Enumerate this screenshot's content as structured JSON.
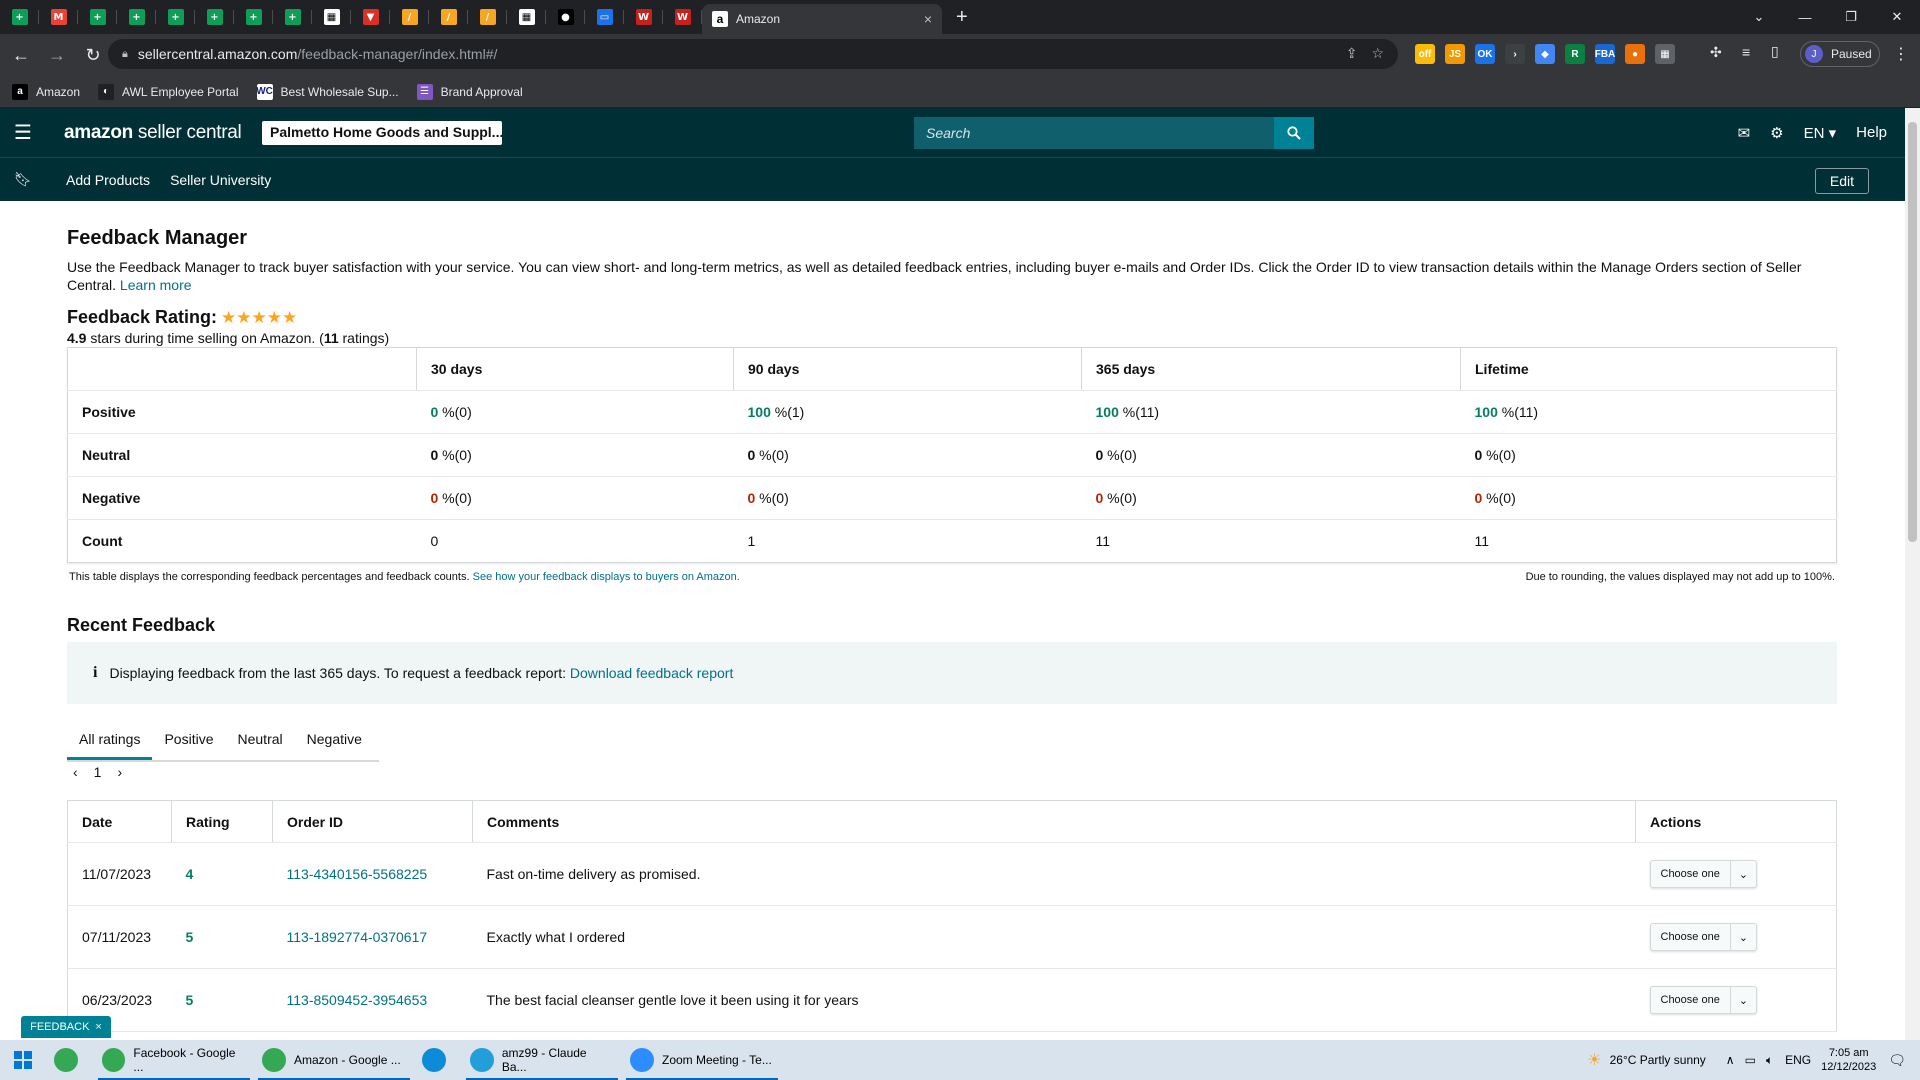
{
  "browser": {
    "favicon_tabs": [
      {
        "icon": "sheets-icon",
        "color": "#0f9d58",
        "glyph": "+"
      },
      {
        "icon": "gmail-icon",
        "color": "#ea4335",
        "glyph": "M"
      },
      {
        "icon": "sheets-icon",
        "color": "#0f9d58",
        "glyph": "+"
      },
      {
        "icon": "sheets-icon",
        "color": "#0f9d58",
        "glyph": "+"
      },
      {
        "icon": "sheets-icon",
        "color": "#0f9d58",
        "glyph": "+"
      },
      {
        "icon": "sheets-icon",
        "color": "#0f9d58",
        "glyph": "+"
      },
      {
        "icon": "sheets-icon",
        "color": "#0f9d58",
        "glyph": "+"
      },
      {
        "icon": "sheets-icon",
        "color": "#0f9d58",
        "glyph": "+"
      },
      {
        "icon": "app-icon",
        "color": "#ffffff",
        "glyph": "▦"
      },
      {
        "icon": "red-arrow-icon",
        "color": "#d93025",
        "glyph": "▼"
      },
      {
        "icon": "stripe-icon",
        "color": "#f5a623",
        "glyph": "/"
      },
      {
        "icon": "stripe-icon",
        "color": "#f5a623",
        "glyph": "/"
      },
      {
        "icon": "stripe-icon",
        "color": "#f5a623",
        "glyph": "/"
      },
      {
        "icon": "app-icon",
        "color": "#ffffff",
        "glyph": "▦"
      },
      {
        "icon": "person-icon",
        "color": "#000000",
        "glyph": "●"
      },
      {
        "icon": "app-blue-icon",
        "color": "#1a73e8",
        "glyph": "▭"
      },
      {
        "icon": "w-icon",
        "color": "#c5221f",
        "glyph": "W"
      },
      {
        "icon": "w-icon",
        "color": "#c5221f",
        "glyph": "W"
      }
    ],
    "active_tab": {
      "title": "Amazon",
      "favicon": "a",
      "close": "×"
    },
    "new_tab": "+",
    "url_host": "sellercentral.amazon.com",
    "url_path": "/feedback-manager/index.html#/",
    "profile": {
      "initial": "J",
      "status": "Paused"
    },
    "extensions": [
      {
        "name": "off-ext-icon",
        "color": "#fbbc04",
        "text": "off"
      },
      {
        "name": "js-ext-icon",
        "color": "#f29900",
        "text": "JS"
      },
      {
        "name": "ok-ext-icon",
        "color": "#1a73e8",
        "text": "OK"
      },
      {
        "name": "arrow-ext-icon",
        "color": "#3c4043",
        "text": "›"
      },
      {
        "name": "diamond-ext-icon",
        "color": "#4285f4",
        "text": "◆"
      },
      {
        "name": "r-ext-icon",
        "color": "#0b8043",
        "text": "R"
      },
      {
        "name": "fba-ext-icon",
        "color": "#1967d2",
        "text": "FBA"
      },
      {
        "name": "circle-ext-icon",
        "color": "#e8710a",
        "text": "●"
      },
      {
        "name": "grid-ext-icon",
        "color": "#5f6368",
        "text": "▦"
      }
    ],
    "bookmarks": [
      {
        "label": "Amazon",
        "icon": "amazon-icon",
        "color": "#000000",
        "glyph": "a"
      },
      {
        "label": "AWL Employee Portal",
        "icon": "awl-icon",
        "color": "#202124",
        "glyph": "◐"
      },
      {
        "label": "Best Wholesale Sup...",
        "icon": "wc-icon",
        "color": "#ffffff",
        "glyph": "WC"
      },
      {
        "label": "Brand Approval",
        "icon": "list-icon",
        "color": "#7e57c2",
        "glyph": "☰"
      }
    ]
  },
  "header": {
    "logo_amazon": "amazon",
    "logo_suffix": " seller central",
    "store": "Palmetto Home Goods and Suppl...",
    "search_placeholder": "Search",
    "language": "EN",
    "help": "Help",
    "nav": [
      "Add Products",
      "Seller University"
    ],
    "edit": "Edit"
  },
  "page": {
    "title": "Feedback Manager",
    "description": "Use the Feedback Manager to track buyer satisfaction with your service. You can view short- and long-term metrics, as well as detailed feedback entries, including buyer e-mails and Order IDs. Click the Order ID to view transaction details within the Manage Orders section of Seller Central.",
    "learn_more": "Learn more",
    "rating_label": "Feedback Rating:",
    "stars": "★★★★★",
    "rating_value": "4.9",
    "rating_text_mid": " stars during time selling on Amazon. (",
    "rating_count": "11",
    "rating_text_end": " ratings)"
  },
  "metrics": {
    "columns": [
      "30 days",
      "90 days",
      "365 days",
      "Lifetime"
    ],
    "rows": [
      {
        "label": "Positive",
        "cells": [
          {
            "v": "0",
            "rest": " %(0)",
            "cls": "g"
          },
          {
            "v": "100",
            "rest": " %(1)",
            "cls": "g"
          },
          {
            "v": "100",
            "rest": " %(11)",
            "cls": "g"
          },
          {
            "v": "100",
            "rest": " %(11)",
            "cls": "g"
          }
        ]
      },
      {
        "label": "Neutral",
        "cells": [
          {
            "v": "0",
            "rest": " %(0)",
            "cls": "n"
          },
          {
            "v": "0",
            "rest": " %(0)",
            "cls": "n"
          },
          {
            "v": "0",
            "rest": " %(0)",
            "cls": "n"
          },
          {
            "v": "0",
            "rest": " %(0)",
            "cls": "n"
          }
        ]
      },
      {
        "label": "Negative",
        "cells": [
          {
            "v": "0",
            "rest": " %(0)",
            "cls": "r"
          },
          {
            "v": "0",
            "rest": " %(0)",
            "cls": "r"
          },
          {
            "v": "0",
            "rest": " %(0)",
            "cls": "r"
          },
          {
            "v": "0",
            "rest": " %(0)",
            "cls": "r"
          }
        ]
      },
      {
        "label": "Count",
        "cells": [
          {
            "v": "0",
            "rest": "",
            "cls": ""
          },
          {
            "v": "1",
            "rest": "",
            "cls": ""
          },
          {
            "v": "11",
            "rest": "",
            "cls": ""
          },
          {
            "v": "11",
            "rest": "",
            "cls": ""
          }
        ]
      }
    ],
    "note_left": "This table displays the corresponding feedback percentages and feedback counts.",
    "note_link": "See how your feedback displays to buyers on Amazon.",
    "note_right": "Due to rounding, the values displayed may not add up to 100%."
  },
  "recent": {
    "title": "Recent Feedback",
    "info_icon": "i",
    "info_text": "Displaying feedback from the last 365 days. To request a feedback report:",
    "info_link": "Download feedback report",
    "tabs": [
      "All ratings",
      "Positive",
      "Neutral",
      "Negative"
    ],
    "page": "1",
    "columns": [
      "Date",
      "Rating",
      "Order ID",
      "Comments",
      "Actions"
    ],
    "rows": [
      {
        "date": "11/07/2023",
        "rating": "4",
        "order": "113-4340156-5568225",
        "comment": "Fast on-time delivery as promised.",
        "action": "Choose one"
      },
      {
        "date": "07/11/2023",
        "rating": "5",
        "order": "113-1892774-0370617",
        "comment": "Exactly what I ordered",
        "action": "Choose one"
      },
      {
        "date": "06/23/2023",
        "rating": "5",
        "order": "113-8509452-3954653",
        "comment": "The best facial cleanser gentle love it been using it for years",
        "action": "Choose one"
      }
    ]
  },
  "feedback_tab": {
    "label": "FEEDBACK",
    "close": "×"
  },
  "taskbar": {
    "items": [
      {
        "label": "",
        "icon": "chrome-icon",
        "color": "#34a853"
      },
      {
        "label": "Facebook - Google ...",
        "icon": "chrome-icon",
        "color": "#34a853"
      },
      {
        "label": "Amazon - Google ...",
        "icon": "chrome-icon",
        "color": "#34a853"
      },
      {
        "label": "",
        "icon": "edge-icon",
        "color": "#0c8bd8"
      },
      {
        "label": "amz99 - Claude Ba...",
        "icon": "telegram-icon",
        "color": "#229ed9"
      },
      {
        "label": "Zoom Meeting - Te...",
        "icon": "zoom-icon",
        "color": "#2d8cff"
      }
    ],
    "weather": "26°C  Partly sunny",
    "lang": "ENG",
    "time": "7:05 am",
    "date": "12/12/2023"
  }
}
